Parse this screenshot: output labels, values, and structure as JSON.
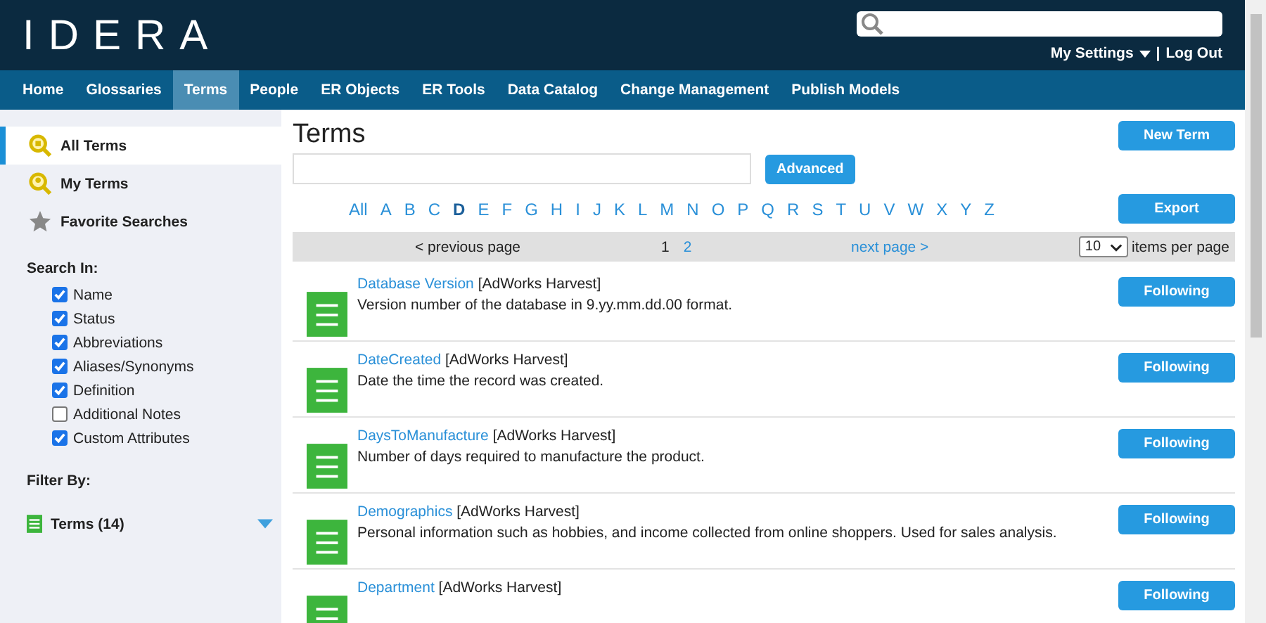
{
  "header": {
    "logo": "IDERA",
    "settings": "My Settings",
    "separator": "|",
    "logout": "Log Out"
  },
  "nav": [
    {
      "label": "Home",
      "selected": false
    },
    {
      "label": "Glossaries",
      "selected": false
    },
    {
      "label": "Terms",
      "selected": true
    },
    {
      "label": "People",
      "selected": false
    },
    {
      "label": "ER Objects",
      "selected": false
    },
    {
      "label": "ER Tools",
      "selected": false
    },
    {
      "label": "Data Catalog",
      "selected": false
    },
    {
      "label": "Change Management",
      "selected": false
    },
    {
      "label": "Publish Models",
      "selected": false
    }
  ],
  "sidebar": {
    "items": [
      {
        "label": "All Terms",
        "selected": true,
        "kind": "all"
      },
      {
        "label": "My Terms",
        "selected": false,
        "kind": "mine"
      },
      {
        "label": "Favorite Searches",
        "selected": false,
        "kind": "favorite"
      }
    ],
    "search_in": {
      "title": "Search In:",
      "options": [
        {
          "label": "Name",
          "checked": true
        },
        {
          "label": "Status",
          "checked": true
        },
        {
          "label": "Abbreviations",
          "checked": true
        },
        {
          "label": "Aliases/Synonyms",
          "checked": true
        },
        {
          "label": "Definition",
          "checked": true
        },
        {
          "label": "Additional Notes",
          "checked": false
        },
        {
          "label": "Custom Attributes",
          "checked": true
        }
      ]
    },
    "filter_by": {
      "title": "Filter By:",
      "items": [
        {
          "label": "Terms",
          "count": "(14)"
        }
      ]
    }
  },
  "main": {
    "title": "Terms",
    "new_button": "New Term",
    "advanced_button": "Advanced",
    "export_button": "Export",
    "letters": [
      {
        "label": "All",
        "selected": false
      },
      {
        "label": "A",
        "selected": false
      },
      {
        "label": "B",
        "selected": false
      },
      {
        "label": "C",
        "selected": false
      },
      {
        "label": "D",
        "selected": true
      },
      {
        "label": "E",
        "selected": false
      },
      {
        "label": "F",
        "selected": false
      },
      {
        "label": "G",
        "selected": false
      },
      {
        "label": "H",
        "selected": false
      },
      {
        "label": "I",
        "selected": false
      },
      {
        "label": "J",
        "selected": false
      },
      {
        "label": "K",
        "selected": false
      },
      {
        "label": "L",
        "selected": false
      },
      {
        "label": "M",
        "selected": false
      },
      {
        "label": "N",
        "selected": false
      },
      {
        "label": "O",
        "selected": false
      },
      {
        "label": "P",
        "selected": false
      },
      {
        "label": "Q",
        "selected": false
      },
      {
        "label": "R",
        "selected": false
      },
      {
        "label": "S",
        "selected": false
      },
      {
        "label": "T",
        "selected": false
      },
      {
        "label": "U",
        "selected": false
      },
      {
        "label": "V",
        "selected": false
      },
      {
        "label": "W",
        "selected": false
      },
      {
        "label": "X",
        "selected": false
      },
      {
        "label": "Y",
        "selected": false
      },
      {
        "label": "Z",
        "selected": false
      }
    ],
    "pager": {
      "previous": "< previous page",
      "pages": [
        {
          "label": "1",
          "selected": true
        },
        {
          "label": "2",
          "selected": false
        }
      ],
      "next": "next page >",
      "per_page": "10",
      "per_page_label": "items per page"
    },
    "terms": [
      {
        "name": "Database Version",
        "source": "[AdWorks Harvest]",
        "description": "Version number of the database in 9.yy.mm.dd.00 format.",
        "button": "Following"
      },
      {
        "name": "DateCreated",
        "source": "[AdWorks Harvest]",
        "description": "Date the time the record was created.",
        "button": "Following"
      },
      {
        "name": "DaysToManufacture",
        "source": "[AdWorks Harvest]",
        "description": "Number of days required to manufacture the product.",
        "button": "Following"
      },
      {
        "name": "Demographics",
        "source": "[AdWorks Harvest]",
        "description": "Personal information such as hobbies, and income collected from online shoppers. Used for sales analysis.",
        "button": "Following"
      },
      {
        "name": "Department",
        "source": "[AdWorks Harvest]",
        "button": "Following"
      }
    ]
  }
}
